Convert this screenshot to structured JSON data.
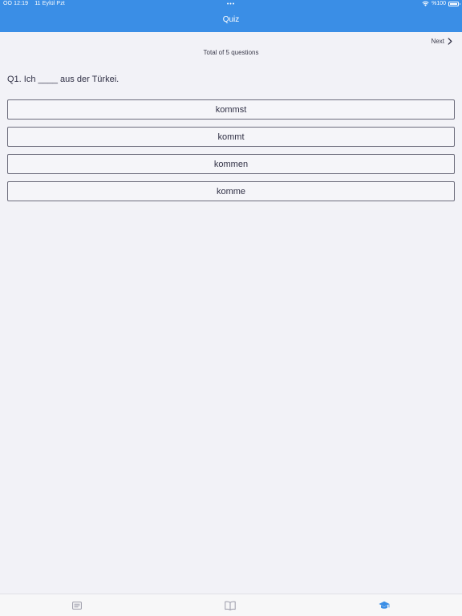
{
  "status_bar": {
    "time": "ÖÖ 12:19",
    "date": "11 Eylül Pzt",
    "center_dots": "•••",
    "battery": "%100"
  },
  "nav": {
    "title": "Quiz"
  },
  "quiz": {
    "next_label": "Next",
    "total_text": "Total of 5 questions",
    "question": "Q1. Ich ____ aus der Türkei.",
    "options": [
      "kommst",
      "kommt",
      "kommen",
      "komme"
    ]
  },
  "tabbar": {
    "tabs": [
      {
        "icon": "list-icon",
        "selected": false
      },
      {
        "icon": "book-icon",
        "selected": false
      },
      {
        "icon": "graduation-cap-icon",
        "selected": true
      }
    ]
  },
  "colors": {
    "accent": "#3a8ee6",
    "background": "#f2f2f7",
    "text": "#3a3a4a",
    "tab_inactive": "#9a9aa8"
  }
}
